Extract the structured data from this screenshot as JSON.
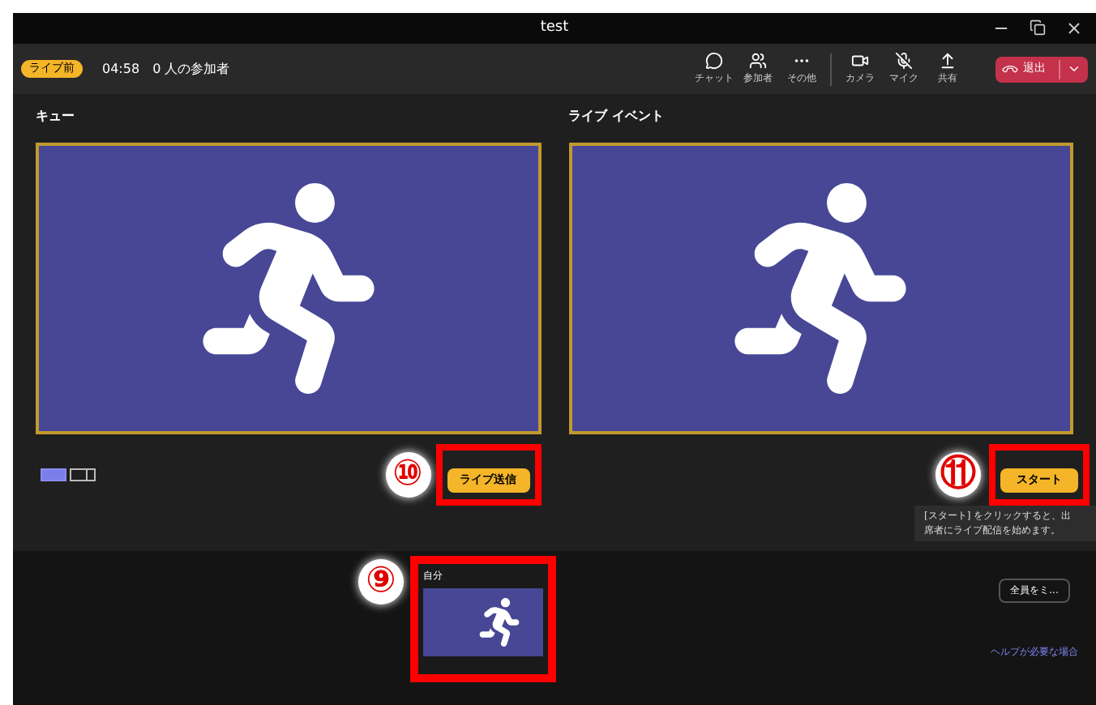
{
  "window": {
    "title": "test"
  },
  "toolbar": {
    "status_badge": "ライブ前",
    "timer": "04:58",
    "participants": "0 人の参加者",
    "actions": [
      {
        "kind": "chat",
        "label": "チャット"
      },
      {
        "kind": "people",
        "label": "参加者"
      },
      {
        "kind": "more",
        "label": "その他"
      },
      {
        "kind": "camera",
        "label": "カメラ"
      },
      {
        "kind": "mic_off",
        "label": "マイク"
      },
      {
        "kind": "share",
        "label": "共有"
      }
    ],
    "leave_button": "退出"
  },
  "queue": {
    "title": "キュー",
    "layouts": [
      {
        "kind": "single",
        "selected": true
      },
      {
        "kind": "split",
        "selected": false
      }
    ],
    "send_button": "ライブ送信",
    "marker": "⑩"
  },
  "live_event": {
    "title": "ライブ イベント",
    "start_button": "スタート",
    "marker": "⑪",
    "tooltip": [
      "[スタート] をクリックすると、出",
      "席者にライブ配信を始めます。"
    ]
  },
  "participants_strip": {
    "marker": "⑨",
    "self_label": "自分",
    "mute_all_button": "全員をミ...",
    "help_link": "ヘルプが必要な場合"
  }
}
